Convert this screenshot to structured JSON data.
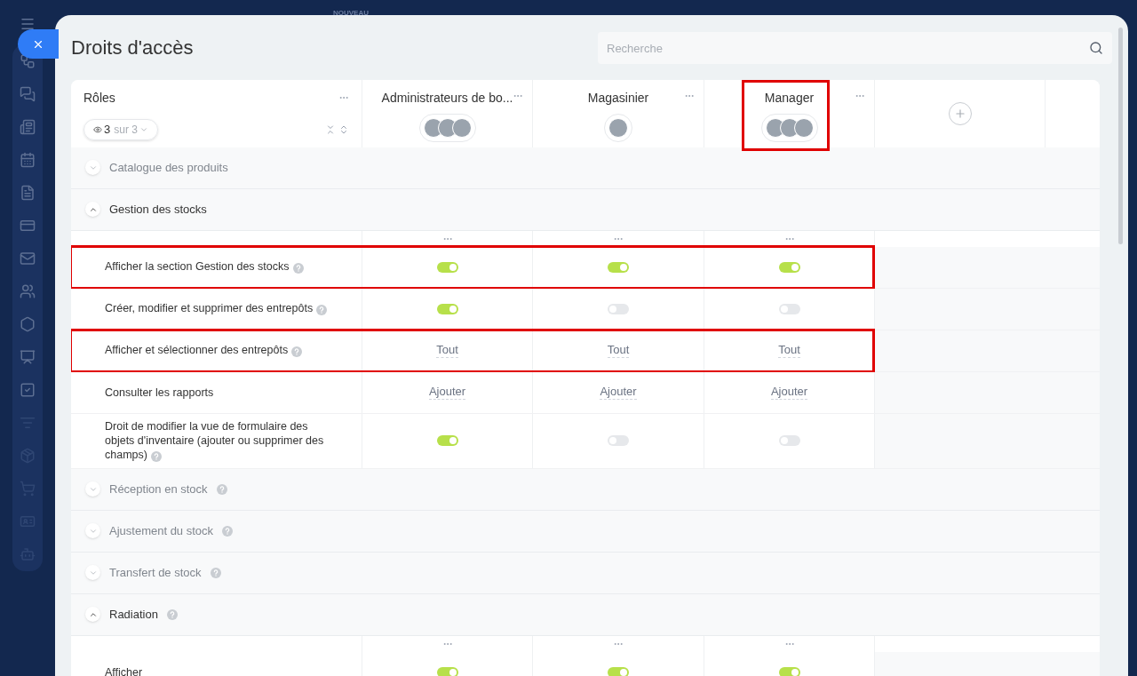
{
  "background": {
    "label": "NOUVEAU"
  },
  "page": {
    "title": "Droits d'accès",
    "search": {
      "placeholder": "Recherche"
    }
  },
  "roles_header": {
    "title": "Rôles",
    "filter": {
      "count": "3",
      "total": "sur 3"
    }
  },
  "columns": [
    {
      "name": "Administrateurs de bo...",
      "highlighted": false,
      "avatars": [
        {
          "kind": "photo"
        },
        {
          "kind": "photo"
        },
        {
          "kind": "photo"
        }
      ]
    },
    {
      "name": "Magasinier",
      "highlighted": false,
      "avatars": [
        {
          "kind": "photo"
        }
      ]
    },
    {
      "name": "Manager",
      "highlighted": true,
      "avatars": [
        {
          "kind": "photo"
        },
        {
          "kind": "photo"
        },
        {
          "kind": "photo"
        }
      ]
    }
  ],
  "sections": [
    {
      "title": "Catalogue des produits",
      "expanded": false,
      "help": false
    },
    {
      "title": "Gestion des stocks",
      "expanded": true,
      "help": false,
      "rows": [
        {
          "label": "Afficher la section Gestion des stocks",
          "help": true,
          "highlighted": true,
          "cells": [
            {
              "kind": "toggle",
              "on": true
            },
            {
              "kind": "toggle",
              "on": true
            },
            {
              "kind": "toggle",
              "on": true
            }
          ]
        },
        {
          "label": "Créer, modifier et supprimer des entrepôts",
          "help": true,
          "highlighted": false,
          "cells": [
            {
              "kind": "toggle",
              "on": true
            },
            {
              "kind": "toggle",
              "on": false
            },
            {
              "kind": "toggle",
              "on": false
            }
          ]
        },
        {
          "label": "Afficher et sélectionner des entrepôts",
          "help": true,
          "highlighted": true,
          "cells": [
            {
              "kind": "link",
              "text": "Tout"
            },
            {
              "kind": "link",
              "text": "Tout"
            },
            {
              "kind": "link",
              "text": "Tout"
            }
          ]
        },
        {
          "label": "Consulter les rapports",
          "help": false,
          "highlighted": false,
          "cells": [
            {
              "kind": "link",
              "text": "Ajouter"
            },
            {
              "kind": "link",
              "text": "Ajouter"
            },
            {
              "kind": "link",
              "text": "Ajouter"
            }
          ]
        },
        {
          "label": "Droit de modifier la vue de formulaire des objets d'inventaire (ajouter ou supprimer des champs)",
          "help": true,
          "highlighted": false,
          "cells": [
            {
              "kind": "toggle",
              "on": true
            },
            {
              "kind": "toggle",
              "on": false
            },
            {
              "kind": "toggle",
              "on": false
            }
          ]
        }
      ]
    },
    {
      "title": "Réception en stock",
      "expanded": false,
      "help": true
    },
    {
      "title": "Ajustement du stock",
      "expanded": false,
      "help": true
    },
    {
      "title": "Transfert de stock",
      "expanded": false,
      "help": true
    },
    {
      "title": "Radiation",
      "expanded": true,
      "help": true,
      "rows": [
        {
          "label": "Afficher",
          "help": false,
          "highlighted": false,
          "cells": [
            {
              "kind": "toggle",
              "on": true
            },
            {
              "kind": "toggle",
              "on": true
            },
            {
              "kind": "toggle",
              "on": true
            }
          ]
        }
      ]
    }
  ]
}
